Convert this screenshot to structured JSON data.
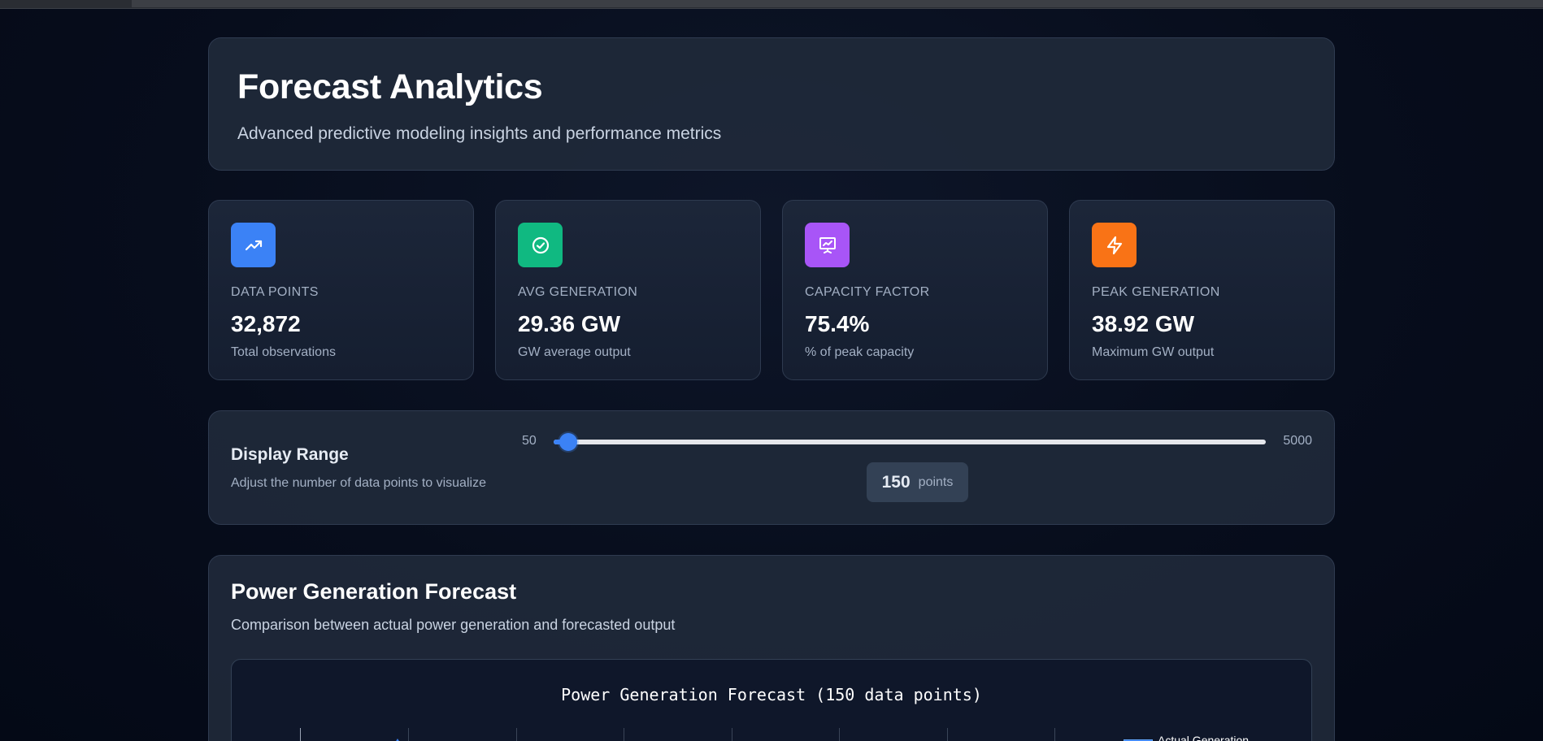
{
  "header": {
    "title": "Forecast Analytics",
    "subtitle": "Advanced predictive modeling insights and performance metrics"
  },
  "stats": [
    {
      "label": "DATA POINTS",
      "value": "32,872",
      "desc": "Total observations",
      "icon": "trending-up-icon",
      "color": "#3b82f6"
    },
    {
      "label": "AVG GENERATION",
      "value": "29.36 GW",
      "desc": "GW average output",
      "icon": "check-circle-icon",
      "color": "#10b981"
    },
    {
      "label": "CAPACITY FACTOR",
      "value": "75.4%",
      "desc": "% of peak capacity",
      "icon": "presentation-chart-icon",
      "color": "#a855f7"
    },
    {
      "label": "PEAK GENERATION",
      "value": "38.92 GW",
      "desc": "Maximum GW output",
      "icon": "lightning-icon",
      "color": "#f97316"
    }
  ],
  "range": {
    "title": "Display Range",
    "desc": "Adjust the number of data points to visualize",
    "min_label": "50",
    "max_label": "5000",
    "min": 50,
    "max": 5000,
    "value": 150,
    "value_label": "150",
    "unit": "points",
    "accent": "#3b82f6"
  },
  "chart_section": {
    "title": "Power Generation Forecast",
    "subtitle": "Comparison between actual power generation and forecasted output",
    "plot_title": "Power Generation Forecast (150 data points)",
    "legend_label": "Actual Generation"
  }
}
